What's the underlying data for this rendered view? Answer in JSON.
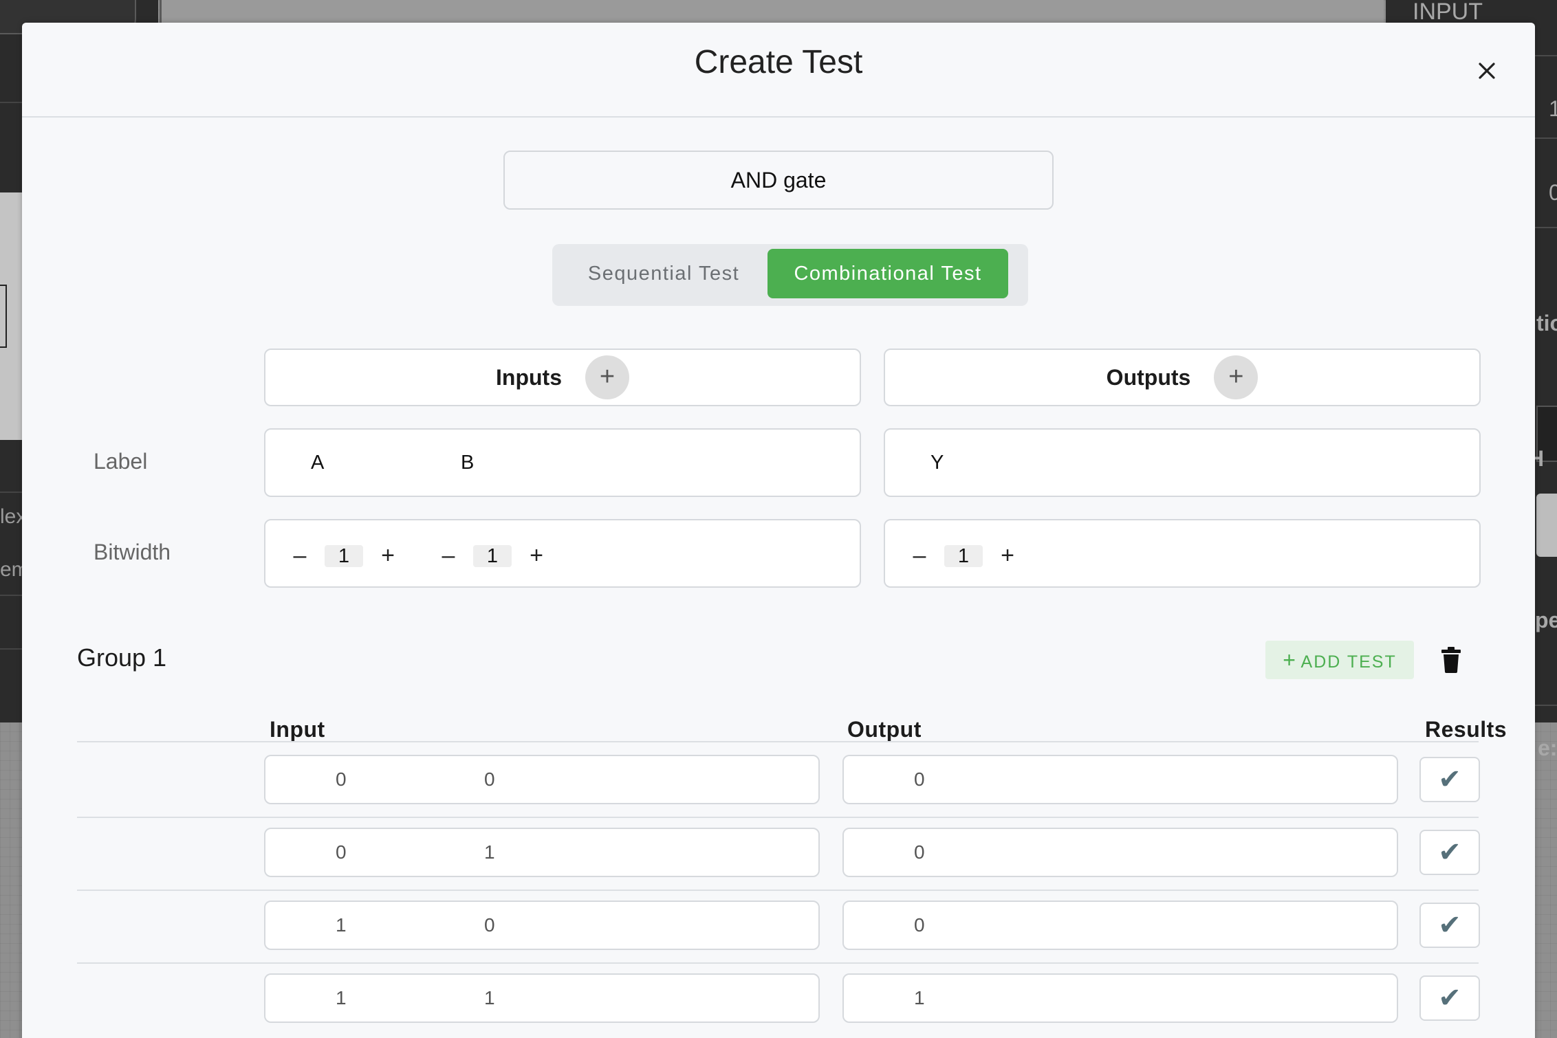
{
  "background": {
    "right_panel_title": "INPUT",
    "right_panel_values": [
      "1",
      "0"
    ],
    "right_panel_fragments": [
      "tio",
      ") H",
      "pe:",
      "e:"
    ],
    "left_panel_fragments": [
      "lex",
      "em"
    ]
  },
  "modal": {
    "title": "Create Test",
    "close_label": "×",
    "test_name_value": "AND gate",
    "test_types": {
      "sequential_label": "Sequential Test",
      "combinational_label": "Combinational Test",
      "selected": "Combinational Test"
    },
    "inputs_header": "Inputs",
    "outputs_header": "Outputs",
    "add_symbol": "+",
    "row_labels": {
      "label": "Label",
      "bitwidth": "Bitwidth"
    },
    "inputs": [
      {
        "label": "A",
        "bitwidth": "1"
      },
      {
        "label": "B",
        "bitwidth": "1"
      }
    ],
    "outputs": [
      {
        "label": "Y",
        "bitwidth": "1"
      }
    ],
    "stepper": {
      "decrement": "–",
      "increment": "+"
    },
    "group": {
      "title": "Group 1",
      "add_test_label": "ADD TEST",
      "add_test_icon": "+",
      "delete_icon": "trash-icon",
      "columns": {
        "input": "Input",
        "output": "Output",
        "results": "Results"
      },
      "rows": [
        {
          "inputs": [
            "0",
            "0"
          ],
          "outputs": [
            "0"
          ],
          "result": "✔"
        },
        {
          "inputs": [
            "0",
            "1"
          ],
          "outputs": [
            "0"
          ],
          "result": "✔"
        },
        {
          "inputs": [
            "1",
            "0"
          ],
          "outputs": [
            "0"
          ],
          "result": "✔"
        },
        {
          "inputs": [
            "1",
            "1"
          ],
          "outputs": [
            "1"
          ],
          "result": "✔"
        }
      ]
    }
  },
  "colors": {
    "accent_green": "#4caf50",
    "add_test_bg": "#e4f2e5",
    "check_color": "#56707a"
  }
}
